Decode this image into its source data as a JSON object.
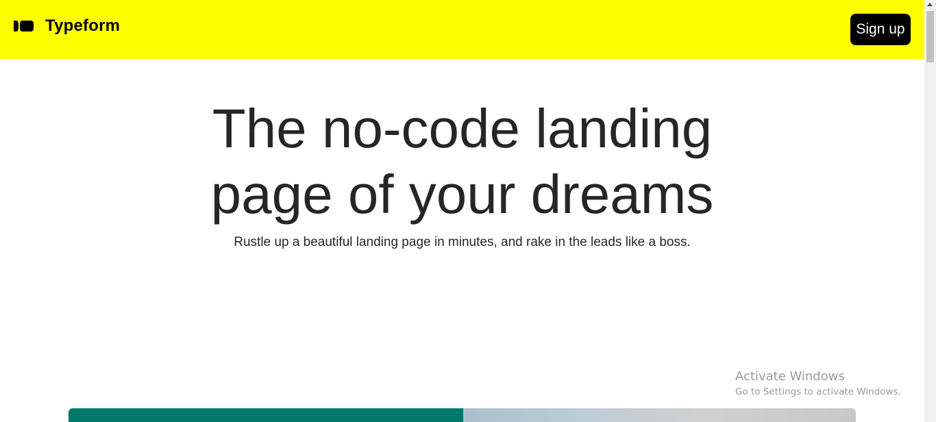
{
  "header": {
    "brand": "Typeform",
    "logo_icon": "typeform-logo-icon",
    "signup_label": "Sign up",
    "background": "#ffff00"
  },
  "hero": {
    "title_line1": "The no-code landing",
    "title_line2": "page of your dreams",
    "subtitle": "Rustle up a beautiful landing page in minutes, and rake in the leads like a boss."
  },
  "preview": {
    "left_color": "#00796b"
  },
  "watermark": {
    "title": "Activate Windows",
    "subtitle": "Go to Settings to activate Windows."
  }
}
